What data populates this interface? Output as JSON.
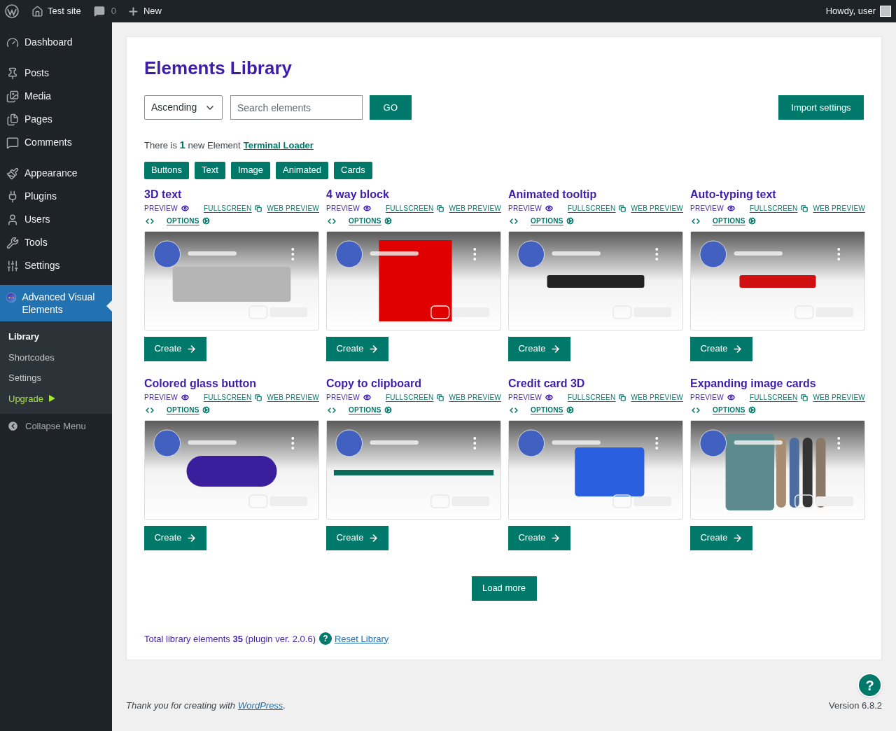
{
  "topbar": {
    "site": "Test site",
    "comments": "0",
    "new": "New",
    "greeting": "Howdy, user"
  },
  "sidebar": {
    "items": [
      {
        "label": "Dashboard",
        "selected": false
      },
      {
        "label": "Posts",
        "selected": false
      },
      {
        "label": "Media",
        "selected": false
      },
      {
        "label": "Pages",
        "selected": false
      },
      {
        "label": "Comments",
        "selected": false
      },
      {
        "label": "Appearance",
        "selected": false
      },
      {
        "label": "Plugins",
        "selected": false
      },
      {
        "label": "Users",
        "selected": false
      },
      {
        "label": "Tools",
        "selected": false
      },
      {
        "label": "Settings",
        "selected": false
      },
      {
        "label": "Advanced Visual Elements",
        "selected": true
      }
    ],
    "submenu": [
      {
        "label": "Library",
        "kind": "link",
        "selected": true
      },
      {
        "label": "Shortcodes",
        "kind": "link",
        "selected": false
      },
      {
        "label": "Settings",
        "kind": "link",
        "selected": false
      },
      {
        "label": "Upgrade",
        "kind": "upgrade",
        "selected": false
      }
    ],
    "collapse": "Collapse Menu"
  },
  "main": {
    "title": "Elements Library",
    "sort": {
      "value": "Ascending"
    },
    "search": {
      "placeholder": "Search elements"
    },
    "go": "GO",
    "import": "Import settings",
    "notice": "There is **1** new Element",
    "notice_link": "Terminal Loader",
    "filters": [
      "Buttons",
      "Text",
      "Image",
      "Animated",
      "Cards"
    ],
    "elements": [
      {
        "title": "3D text",
        "preview": "PREVIEW",
        "fullscreen": "FULLSCREEN",
        "web_preview": "WEB PREVIEW",
        "options": "OPTIONS",
        "create": "Create"
      },
      {
        "title": "4 way block",
        "preview": "PREVIEW",
        "fullscreen": "FULLSCREEN",
        "web_preview": "WEB PREVIEW",
        "options": "OPTIONS",
        "create": "Create"
      },
      {
        "title": "Animated tooltip",
        "preview": "PREVIEW",
        "fullscreen": "FULLSCREEN",
        "web_preview": "WEB PREVIEW",
        "options": "OPTIONS",
        "create": "Create"
      },
      {
        "title": "Auto-typing text",
        "preview": "PREVIEW",
        "fullscreen": "FULLSCREEN",
        "web_preview": "WEB PREVIEW",
        "options": "OPTIONS",
        "create": "Create"
      },
      {
        "title": "Colored glass button",
        "preview": "PREVIEW",
        "fullscreen": "FULLSCREEN",
        "web_preview": "WEB PREVIEW",
        "options": "OPTIONS",
        "create": "Create"
      },
      {
        "title": "Copy to clipboard",
        "preview": "PREVIEW",
        "fullscreen": "FULLSCREEN",
        "web_preview": "WEB PREVIEW",
        "options": "OPTIONS",
        "create": "Create"
      },
      {
        "title": "Credit card 3D",
        "preview": "PREVIEW",
        "fullscreen": "FULLSCREEN",
        "web_preview": "WEB PREVIEW",
        "options": "OPTIONS",
        "create": "Create"
      },
      {
        "title": "Expanding image cards",
        "preview": "PREVIEW",
        "fullscreen": "FULLSCREEN",
        "web_preview": "WEB PREVIEW",
        "options": "OPTIONS",
        "create": "Create"
      }
    ],
    "load_more": "Load more",
    "total": "Total library elements **35** (plugin ver. 2.0.6)",
    "help": "?",
    "reset": "Reset Library"
  },
  "footer": {
    "thanks": "Thank you for creating with",
    "link": "WordPress",
    "period": ".",
    "version": "Version 6.8.2",
    "help": "?"
  }
}
